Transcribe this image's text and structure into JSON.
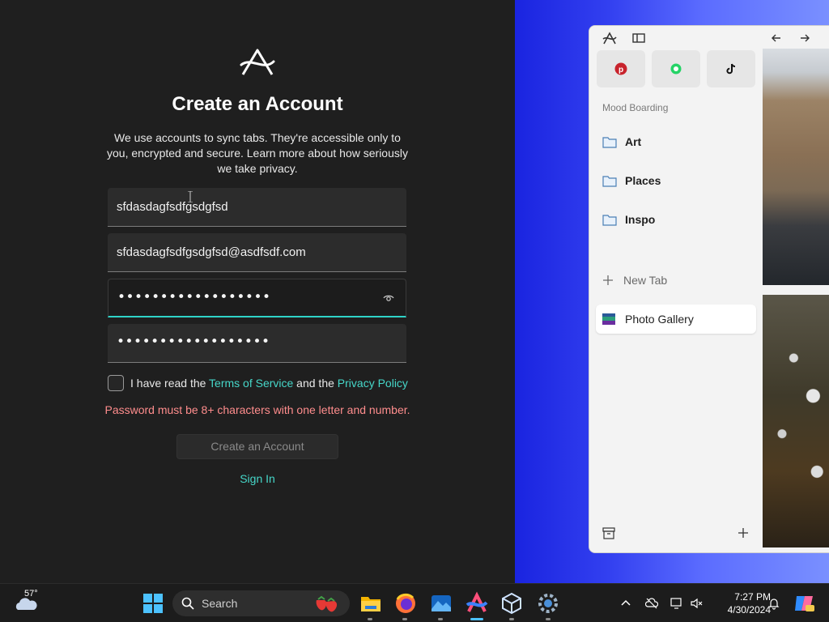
{
  "signup": {
    "title": "Create an Account",
    "description": "We use accounts to sync tabs. They're accessible only to you, encrypted and secure. Learn more about how seriously we take privacy.",
    "username": "sfdasdagfsdfgsdgfsd",
    "email": "sfdasdagfsdfgsdgfsd@asdfsdf.com",
    "password": "••••••••••••••••••",
    "confirm_password": "••••••••••••••••••",
    "terms_prefix": "I have read the ",
    "terms_link": "Terms of Service",
    "terms_middle": " and the ",
    "privacy_link": "Privacy Policy",
    "error": "Password must be 8+ characters with one letter and number.",
    "create_button": "Create an Account",
    "sign_in": "Sign In",
    "accent_color": "#46d7c9",
    "error_color": "#ff8d8d"
  },
  "browser": {
    "pinned": [
      "pinterest-icon",
      "whatsapp-icon",
      "tiktok-icon"
    ],
    "section_title": "Mood Boarding",
    "folders": [
      "Art",
      "Places",
      "Inspo"
    ],
    "new_tab": "New Tab",
    "active_tab": "Photo Gallery"
  },
  "taskbar": {
    "temperature": "57°",
    "search_label": "Search",
    "time": "7:27 PM",
    "date": "4/30/2024"
  }
}
